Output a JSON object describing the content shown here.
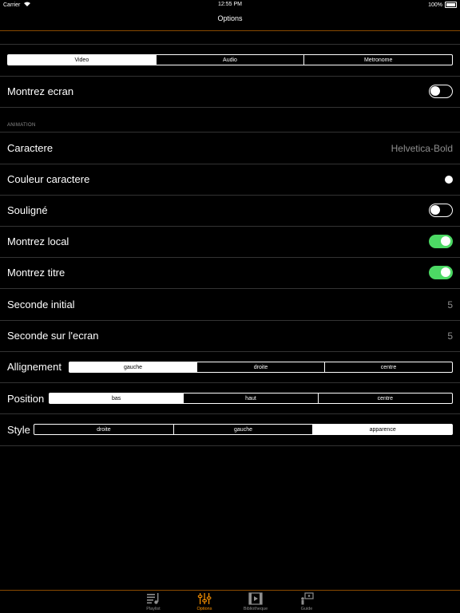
{
  "status": {
    "carrier": "Carrier",
    "time": "12:55 PM",
    "battery": "100%"
  },
  "nav": {
    "title": "Options"
  },
  "tabs_top": {
    "items": [
      "Video",
      "Audio",
      "Metronome"
    ],
    "selected": "Video"
  },
  "rows": {
    "show_screen": {
      "label": "Montrez ecran",
      "on": false
    },
    "section_label": "ANIMATION",
    "caractere": {
      "label": "Caractere",
      "value": "Helvetica-Bold"
    },
    "couleur": {
      "label": "Couleur caractere"
    },
    "souligne": {
      "label": "Souligné",
      "on": false
    },
    "local": {
      "label": "Montrez local",
      "on": true
    },
    "titre": {
      "label": "Montrez titre",
      "on": true
    },
    "seconde_initial": {
      "label": "Seconde initial",
      "value": "5"
    },
    "seconde_ecran": {
      "label": "Seconde sur l'ecran",
      "value": "5"
    }
  },
  "alignement": {
    "label": "Allignement",
    "options": [
      "gauche",
      "droite",
      "centre"
    ],
    "selected": "gauche"
  },
  "position": {
    "label": "Position",
    "options": [
      "bas",
      "haut",
      "centre"
    ],
    "selected": "bas"
  },
  "style": {
    "label": "Style",
    "options": [
      "droite",
      "gauche",
      "apparence"
    ],
    "selected": "apparence"
  },
  "tabbar": {
    "items": [
      {
        "label": "Playlist",
        "icon": "playlist-icon"
      },
      {
        "label": "Options",
        "icon": "sliders-icon"
      },
      {
        "label": "Bibliotheque",
        "icon": "film-icon"
      },
      {
        "label": "Guide",
        "icon": "presenter-icon"
      }
    ],
    "active": "Options",
    "accent": "#ff9500"
  },
  "colors": {
    "switch_on": "#4cd964",
    "accent": "#ff9500"
  }
}
